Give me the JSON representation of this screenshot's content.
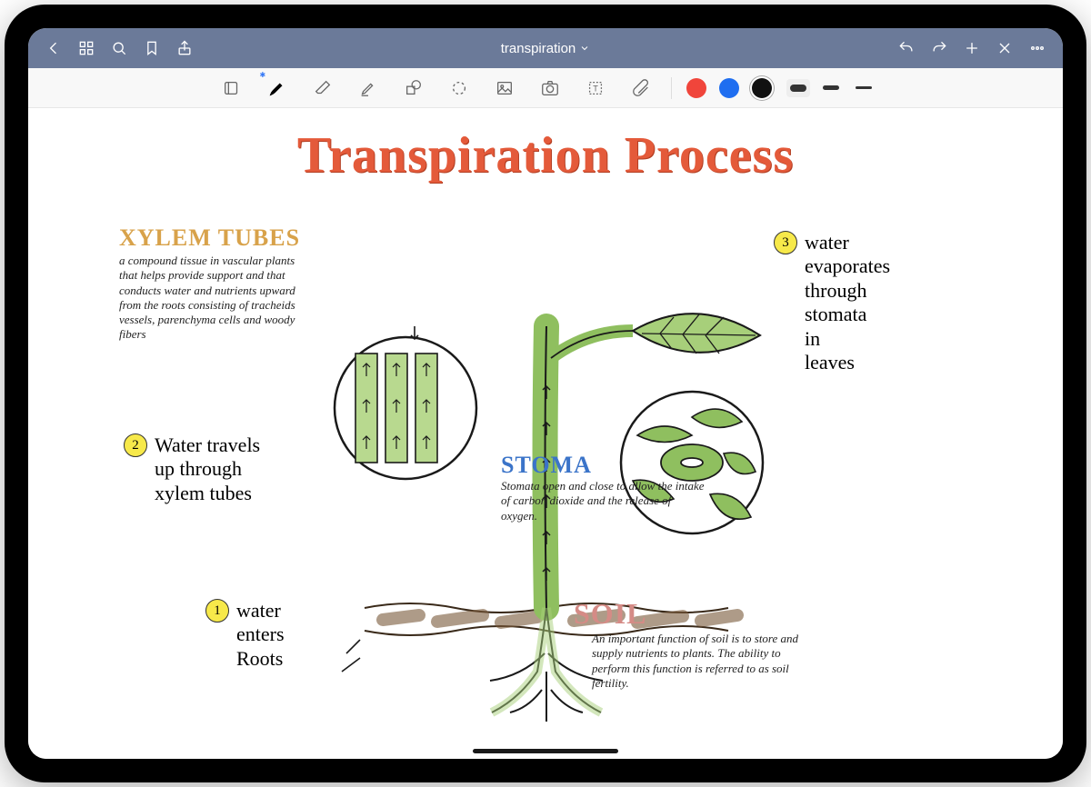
{
  "header": {
    "title": "transpiration"
  },
  "nav_icons": {
    "back": "back-chevron",
    "thumbnails": "grid",
    "search": "search",
    "bookmark": "bookmark",
    "share": "share",
    "undo": "undo",
    "redo": "redo",
    "add": "plus",
    "close": "x",
    "more": "more"
  },
  "tools": [
    {
      "name": "read-mode",
      "icon": "read"
    },
    {
      "name": "pen",
      "icon": "pen",
      "active": true,
      "bluetooth": true
    },
    {
      "name": "eraser",
      "icon": "eraser"
    },
    {
      "name": "highlighter",
      "icon": "highlighter"
    },
    {
      "name": "shapes",
      "icon": "shapes"
    },
    {
      "name": "lasso",
      "icon": "lasso"
    },
    {
      "name": "image",
      "icon": "image"
    },
    {
      "name": "camera",
      "icon": "camera"
    },
    {
      "name": "text",
      "icon": "text"
    },
    {
      "name": "attachment",
      "icon": "paperclip"
    }
  ],
  "colors": [
    {
      "name": "red",
      "hex": "#f0453b",
      "selected": false
    },
    {
      "name": "blue",
      "hex": "#1f6ef0",
      "selected": false
    },
    {
      "name": "black",
      "hex": "#111111",
      "selected": true
    }
  ],
  "strokes": [
    {
      "name": "thick",
      "px": 8,
      "selected": true
    },
    {
      "name": "medium",
      "px": 5,
      "selected": false
    },
    {
      "name": "thin",
      "px": 3,
      "selected": false
    }
  ],
  "note": {
    "title": "Transpiration Process",
    "sections": {
      "xylem": {
        "heading": "XYLEM TUBES",
        "heading_color": "#d8a24a",
        "desc": "a compound tissue in vascular plants that helps provide support and that conducts water and nutrients upward from the roots consisting of tracheids vessels, parenchyma cells and woody fibers"
      },
      "stoma": {
        "heading": "STOMA",
        "heading_color": "#3b74c9",
        "desc": "Stomata open and close to allow the intake of carbon dioxide and the release of oxygen."
      },
      "soil": {
        "heading": "SOIL",
        "heading_color": "#d58b86",
        "desc": "An important function of soil is to store and supply nutrients to plants. The ability to perform this function is referred to as soil fertility."
      }
    },
    "steps": [
      {
        "n": "1",
        "text": "water\nenters\nRoots"
      },
      {
        "n": "2",
        "text": "Water travels\nup through\nxylem tubes"
      },
      {
        "n": "3",
        "text": "water\nevaporates\nthrough\nstomata\nin\nleaves"
      }
    ]
  }
}
